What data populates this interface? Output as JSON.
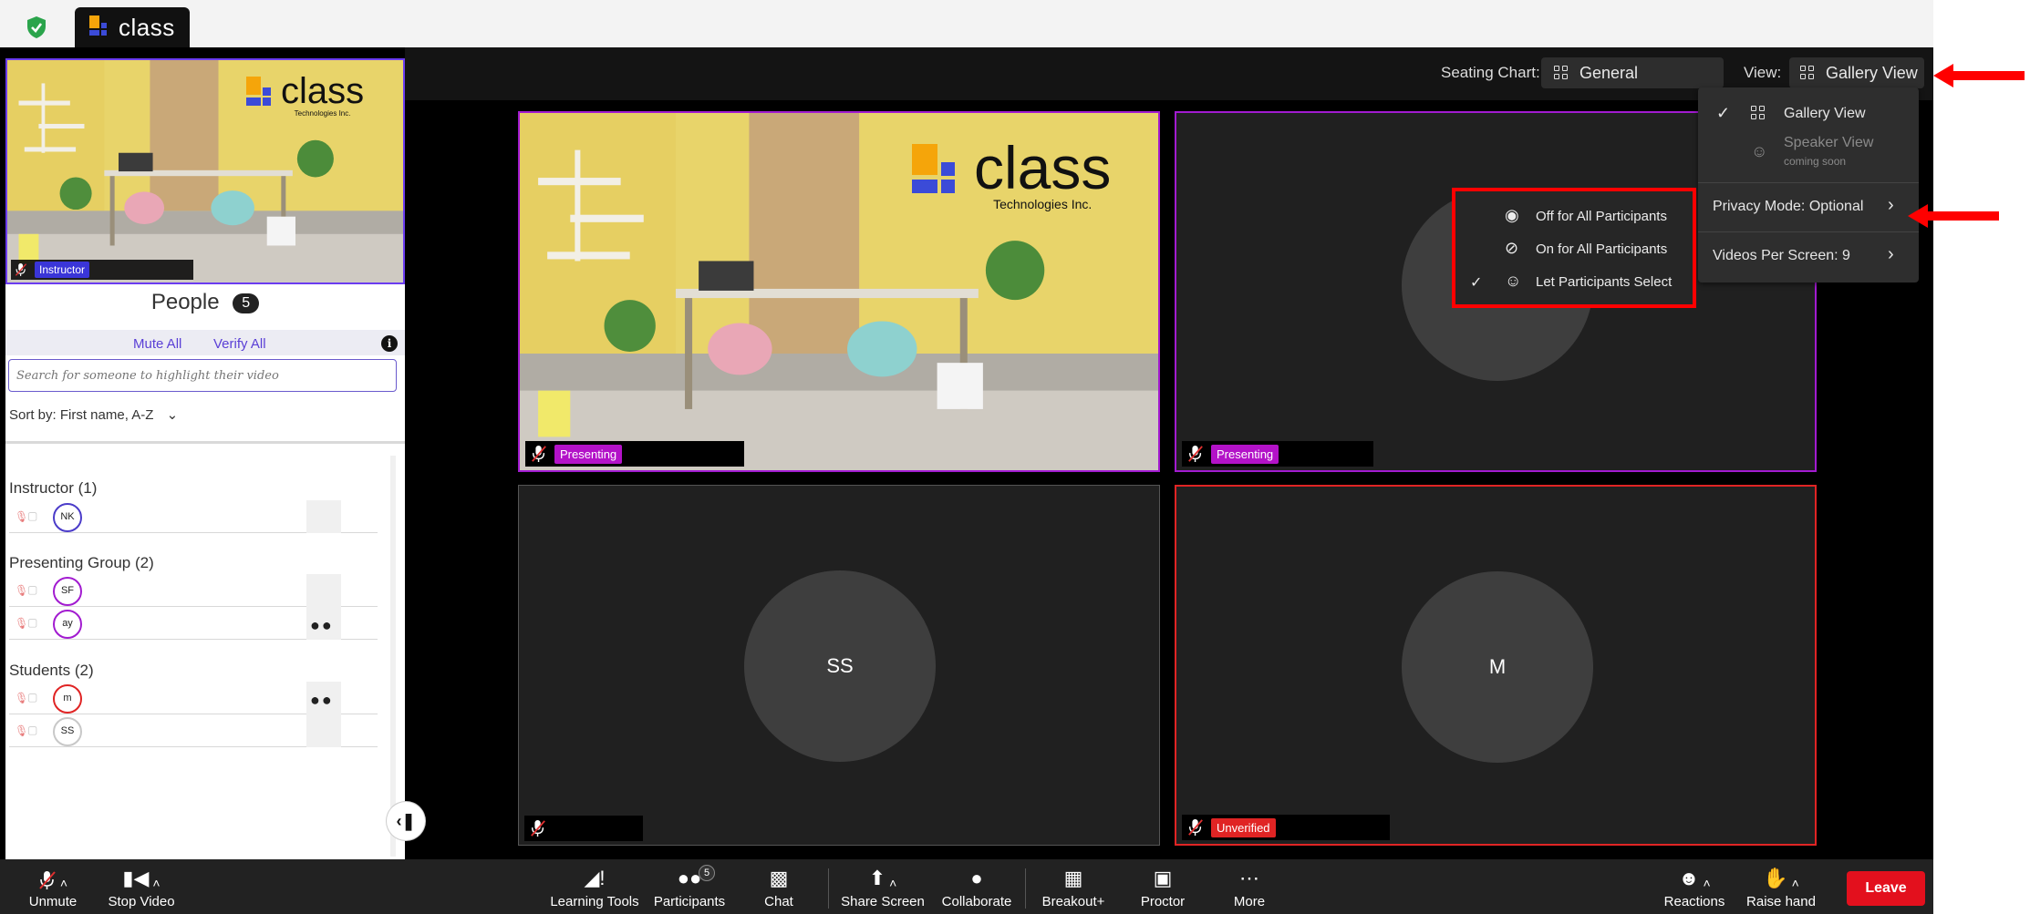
{
  "app": {
    "tab_name": "class"
  },
  "header": {
    "seating_label": "Seating Chart:",
    "seating_value": "General",
    "view_label": "View:",
    "view_value": "Gallery View"
  },
  "view_menu": {
    "gallery": "Gallery View",
    "speaker": "Speaker View",
    "speaker_sub": "coming soon",
    "privacy": "Privacy Mode: Optional",
    "videos_per_screen": "Videos Per Screen: 9"
  },
  "privacy_menu": {
    "off": "Off for All Participants",
    "on": "On for All Participants",
    "select": "Let Participants Select"
  },
  "sidebar": {
    "instructor_tag": "Instructor",
    "people_title": "People",
    "people_count": "5",
    "mute_all": "Mute All",
    "verify_all": "Verify All",
    "search_placeholder": "Search for someone to highlight their video",
    "sort_label": "Sort by:",
    "sort_value": "First name, A-Z",
    "groups": [
      {
        "title": "Instructor (1)",
        "members": [
          {
            "initials": "NK",
            "color": "#4b3cc9"
          }
        ]
      },
      {
        "title": "Presenting Group  (2)",
        "members": [
          {
            "initials": "SF",
            "color": "#a21bd0"
          },
          {
            "initials": "ay",
            "color": "#a21bd0"
          }
        ]
      },
      {
        "title": "Students  (2)",
        "members": [
          {
            "initials": "m",
            "color": "#e02424"
          },
          {
            "initials": "SS",
            "color": "#c8c8c8"
          }
        ]
      }
    ]
  },
  "tiles": {
    "t1_tag": "Presenting",
    "t2_tag": "Presenting",
    "t3_initials": "SS",
    "t4_initials": "M",
    "t4_tag": "Unverified"
  },
  "room_logo": {
    "word": "class",
    "sub": "Technologies Inc."
  },
  "toolbar": {
    "unmute": "Unmute",
    "stop_video": "Stop Video",
    "learning_tools": "Learning Tools",
    "participants": "Participants",
    "participants_badge": "5",
    "chat": "Chat",
    "share_screen": "Share Screen",
    "collaborate": "Collaborate",
    "breakout": "Breakout+",
    "proctor": "Proctor",
    "more": "More",
    "reactions": "Reactions",
    "raise_hand": "Raise hand",
    "leave": "Leave"
  },
  "colors": {
    "accent": "#5a3fd6",
    "presenting": "#b312c8",
    "unverified": "#e02424",
    "annotation": "#ff0000"
  }
}
